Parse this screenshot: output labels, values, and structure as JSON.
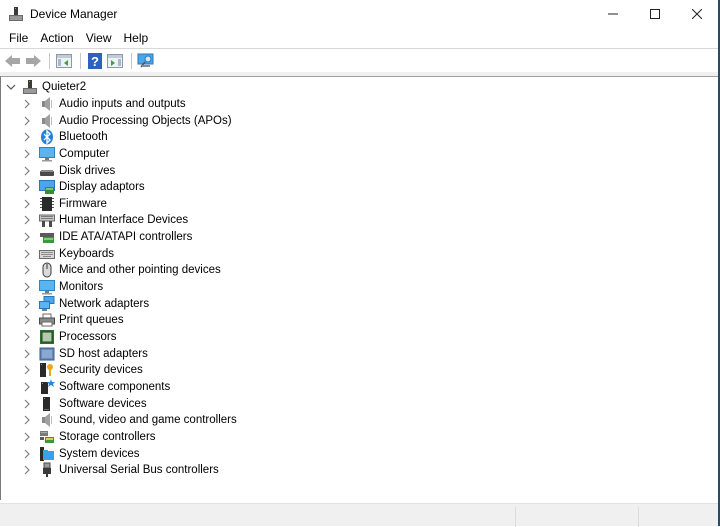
{
  "window": {
    "title": "Device Manager",
    "icon": "device-manager-icon",
    "caption": {
      "minimize": "—",
      "maximize": "☐",
      "close": "✕"
    }
  },
  "menubar": {
    "items": [
      {
        "label": "File"
      },
      {
        "label": "Action"
      },
      {
        "label": "View"
      },
      {
        "label": "Help"
      }
    ]
  },
  "toolbar": {
    "buttons": [
      {
        "name": "back",
        "icon": "back-arrow-icon"
      },
      {
        "name": "forward",
        "icon": "forward-arrow-icon"
      },
      {
        "name": "show-hide-console-tree",
        "icon": "console-tree-icon"
      },
      {
        "name": "help",
        "icon": "help-icon",
        "glyph": "?"
      },
      {
        "name": "show-action-pane",
        "icon": "action-pane-icon"
      },
      {
        "name": "scan-hardware",
        "icon": "scan-monitor-icon"
      }
    ]
  },
  "tree": {
    "root": {
      "label": "Quieter2",
      "expanded": true,
      "icon": "computer-tower-icon",
      "chevron": "⌄"
    },
    "chevron_collapsed": "›",
    "items": [
      {
        "label": "Audio inputs and outputs",
        "icon": "speaker-icon"
      },
      {
        "label": "Audio Processing Objects (APOs)",
        "icon": "speaker-icon"
      },
      {
        "label": "Bluetooth",
        "icon": "bluetooth-icon"
      },
      {
        "label": "Computer",
        "icon": "monitor-icon"
      },
      {
        "label": "Disk drives",
        "icon": "disk-drive-icon"
      },
      {
        "label": "Display adaptors",
        "icon": "display-adapter-icon"
      },
      {
        "label": "Firmware",
        "icon": "firmware-chip-icon"
      },
      {
        "label": "Human Interface Devices",
        "icon": "hid-icon"
      },
      {
        "label": "IDE ATA/ATAPI controllers",
        "icon": "ide-controller-icon"
      },
      {
        "label": "Keyboards",
        "icon": "keyboard-icon"
      },
      {
        "label": "Mice and other pointing devices",
        "icon": "mouse-icon"
      },
      {
        "label": "Monitors",
        "icon": "monitor-icon"
      },
      {
        "label": "Network adapters",
        "icon": "network-adapter-icon"
      },
      {
        "label": "Print queues",
        "icon": "printer-icon"
      },
      {
        "label": "Processors",
        "icon": "processor-icon"
      },
      {
        "label": "SD host adapters",
        "icon": "sd-card-icon"
      },
      {
        "label": "Security devices",
        "icon": "security-key-icon"
      },
      {
        "label": "Software components",
        "icon": "software-component-icon"
      },
      {
        "label": "Software devices",
        "icon": "software-device-icon"
      },
      {
        "label": "Sound, video and game controllers",
        "icon": "speaker-icon"
      },
      {
        "label": "Storage controllers",
        "icon": "storage-controller-icon"
      },
      {
        "label": "System devices",
        "icon": "system-folder-icon"
      },
      {
        "label": "Universal Serial Bus controllers",
        "icon": "usb-icon"
      }
    ]
  },
  "statusbar": {
    "panes": [
      "",
      "",
      ""
    ]
  }
}
